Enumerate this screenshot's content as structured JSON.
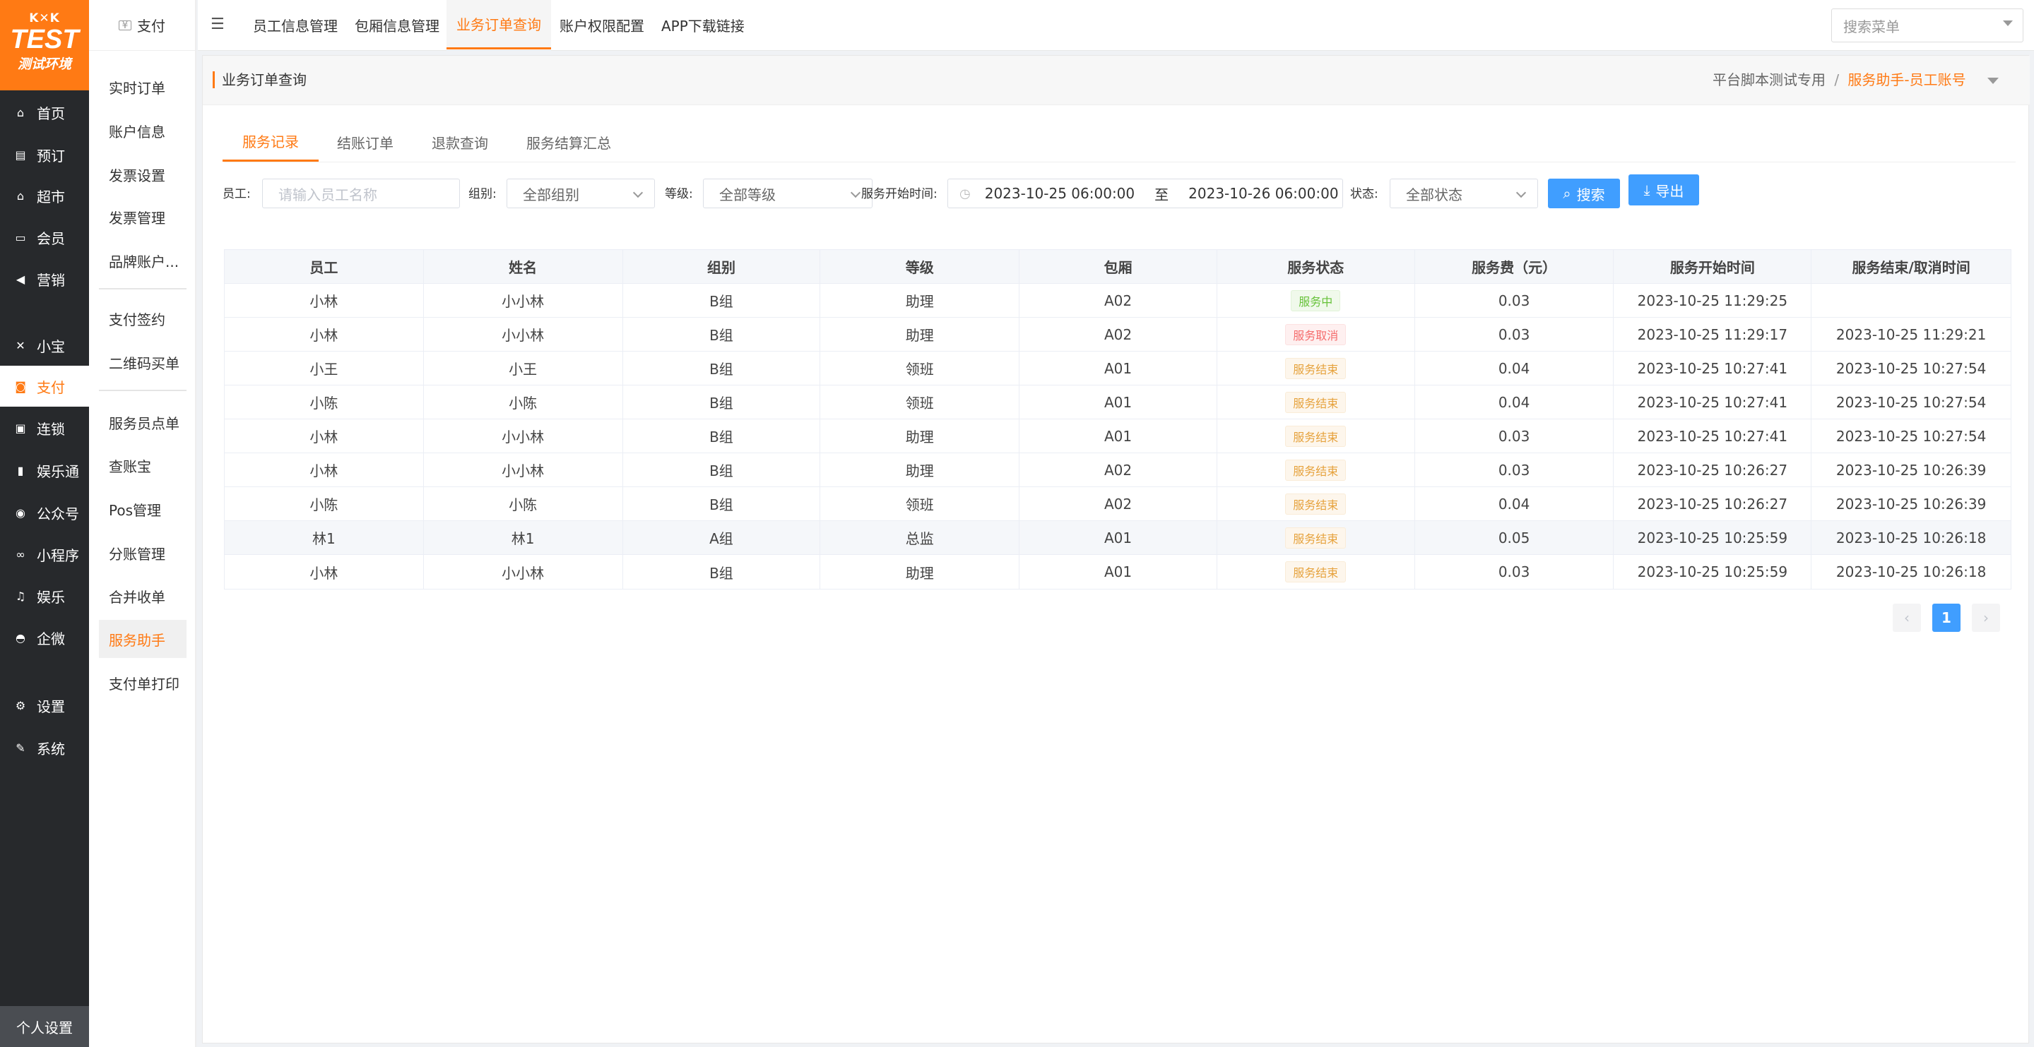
{
  "brand": {
    "kk": "K✕K",
    "test": "TEST",
    "env": "测试环境"
  },
  "left_nav": [
    {
      "label": "首页",
      "icon": "home-icon",
      "glyph": "⌂",
      "active": false
    },
    {
      "label": "预订",
      "icon": "booking-icon",
      "glyph": "▤",
      "active": false
    },
    {
      "label": "超市",
      "icon": "store-icon",
      "glyph": "⌂",
      "active": false
    },
    {
      "label": "会员",
      "icon": "card-icon",
      "glyph": "▭",
      "active": false
    },
    {
      "label": "营销",
      "icon": "megaphone-icon",
      "glyph": "◀",
      "active": false
    },
    {
      "label": "小宝",
      "icon": "xiaobao-icon",
      "glyph": "✕",
      "active": false
    },
    {
      "label": "支付",
      "icon": "payment-icon",
      "glyph": "◙",
      "active": true
    },
    {
      "label": "连锁",
      "icon": "chain-store-icon",
      "glyph": "▣",
      "active": false
    },
    {
      "label": "娱乐通",
      "icon": "bottle-icon",
      "glyph": "▮",
      "active": false
    },
    {
      "label": "公众号",
      "icon": "wechat-icon",
      "glyph": "◉",
      "active": false
    },
    {
      "label": "小程序",
      "icon": "link-icon",
      "glyph": "∞",
      "active": false
    },
    {
      "label": "娱乐",
      "icon": "music-icon",
      "glyph": "♫",
      "active": false
    },
    {
      "label": "企微",
      "icon": "bell-icon",
      "glyph": "◓",
      "active": false
    },
    {
      "label": "设置",
      "icon": "gears-icon",
      "glyph": "⚙",
      "active": false
    },
    {
      "label": "系统",
      "icon": "wrench-icon",
      "glyph": "✎",
      "active": false
    }
  ],
  "personal_settings": "个人设置",
  "sub_nav": {
    "title": "支付",
    "group1": [
      "实时订单",
      "账户信息",
      "发票设置",
      "发票管理",
      "品牌账户..."
    ],
    "group2": [
      "支付签约",
      "二维码买单"
    ],
    "group3": [
      "服务员点单",
      "查账宝",
      "Pos管理",
      "分账管理",
      "合并收单",
      "服务助手",
      "支付单打印"
    ],
    "active": "服务助手"
  },
  "top_tabs": [
    "员工信息管理",
    "包厢信息管理",
    "业务订单查询",
    "账户权限配置",
    "APP下载链接"
  ],
  "top_active": "业务订单查询",
  "search_menu_placeholder": "搜索菜单",
  "page": {
    "title": "业务订单查询",
    "crumb_store": "平台脚本测试专用",
    "crumb_sep": "/",
    "crumb_account": "服务助手-员工账号"
  },
  "content_tabs": [
    "服务记录",
    "结账订单",
    "退款查询",
    "服务结算汇总"
  ],
  "content_active": "服务记录",
  "filters": {
    "employee_label": "员工:",
    "employee_placeholder": "请输入员工名称",
    "group_label": "组别:",
    "group_value": "全部组别",
    "level_label": "等级:",
    "level_value": "全部等级",
    "time_label": "服务开始时间:",
    "time_start": "2023-10-25 06:00:00",
    "time_to": "至",
    "time_end": "2023-10-26 06:00:00",
    "status_label": "状态:",
    "status_value": "全部状态",
    "search_btn": "搜索",
    "export_btn": "导出"
  },
  "table": {
    "columns": [
      "员工",
      "姓名",
      "组别",
      "等级",
      "包厢",
      "服务状态",
      "服务费（元）",
      "服务开始时间",
      "服务结束/取消时间"
    ],
    "rows": [
      [
        "小林",
        "小小林",
        "B组",
        "助理",
        "A02",
        "服务中",
        "0.03",
        "2023-10-25 11:29:25",
        ""
      ],
      [
        "小林",
        "小小林",
        "B组",
        "助理",
        "A02",
        "服务取消",
        "0.03",
        "2023-10-25 11:29:17",
        "2023-10-25 11:29:21"
      ],
      [
        "小王",
        "小王",
        "B组",
        "领班",
        "A01",
        "服务结束",
        "0.04",
        "2023-10-25 10:27:41",
        "2023-10-25 10:27:54"
      ],
      [
        "小陈",
        "小陈",
        "B组",
        "领班",
        "A01",
        "服务结束",
        "0.04",
        "2023-10-25 10:27:41",
        "2023-10-25 10:27:54"
      ],
      [
        "小林",
        "小小林",
        "B组",
        "助理",
        "A01",
        "服务结束",
        "0.03",
        "2023-10-25 10:27:41",
        "2023-10-25 10:27:54"
      ],
      [
        "小林",
        "小小林",
        "B组",
        "助理",
        "A02",
        "服务结束",
        "0.03",
        "2023-10-25 10:26:27",
        "2023-10-25 10:26:39"
      ],
      [
        "小陈",
        "小陈",
        "B组",
        "领班",
        "A02",
        "服务结束",
        "0.04",
        "2023-10-25 10:26:27",
        "2023-10-25 10:26:39"
      ],
      [
        "林1",
        "林1",
        "A组",
        "总监",
        "A01",
        "服务结束",
        "0.05",
        "2023-10-25 10:25:59",
        "2023-10-25 10:26:18"
      ],
      [
        "小林",
        "小小林",
        "B组",
        "助理",
        "A01",
        "服务结束",
        "0.03",
        "2023-10-25 10:25:59",
        "2023-10-25 10:26:18"
      ]
    ]
  },
  "pagination": {
    "current": "1",
    "prev": "‹",
    "next": "›"
  },
  "colors": {
    "accent": "#ff7a14",
    "primary": "#409eff",
    "sidebar": "#27292c"
  }
}
